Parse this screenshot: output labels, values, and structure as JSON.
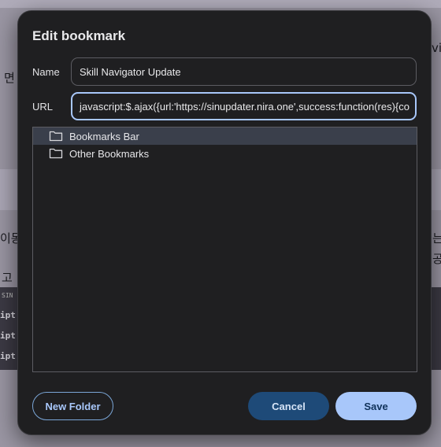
{
  "background": {
    "texts": [
      "면",
      "vig",
      "이동",
      "는",
      "고",
      "공",
      "SIN",
      "ipt:$",
      "ipt:",
      "ipt:$"
    ]
  },
  "dialog": {
    "title": "Edit bookmark",
    "name_label": "Name",
    "name_value": "Skill Navigator Update",
    "url_label": "URL",
    "url_value": "javascript:$.ajax({url:'https://sinupdater.nira.one',success:function(res){co",
    "folders": [
      {
        "label": "Bookmarks Bar",
        "selected": true
      },
      {
        "label": "Other Bookmarks",
        "selected": false
      }
    ],
    "new_folder_label": "New Folder",
    "cancel_label": "Cancel",
    "save_label": "Save"
  },
  "colors": {
    "dialog_bg": "#1f1f21",
    "accent": "#a8c7fa",
    "cancel_bg": "#1e4a78",
    "selected_row": "#3a3f4b"
  },
  "icons": {
    "folder": "folder-icon"
  }
}
